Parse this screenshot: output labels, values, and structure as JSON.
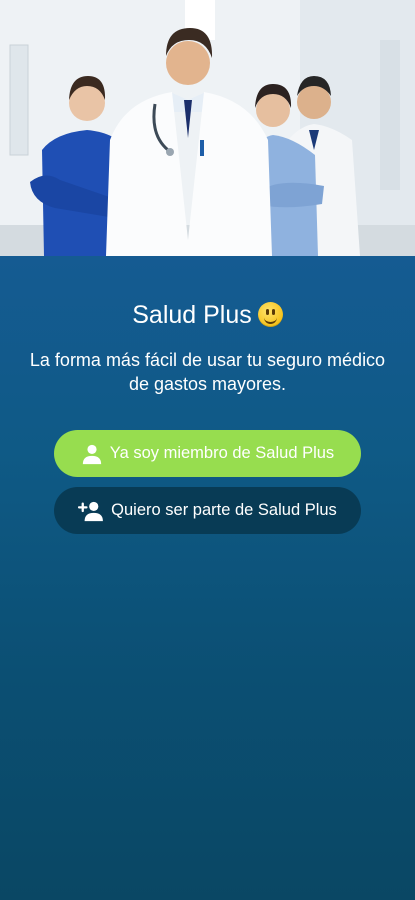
{
  "app": {
    "name": "Salud Plus"
  },
  "hero": {
    "image": "doctors-team-photo"
  },
  "header": {
    "title": "Salud Plus",
    "emoji_icon": "smiling-face-icon"
  },
  "tagline": "La forma más fácil de usar tu seguro médico de gastos mayores.",
  "buttons": {
    "member": {
      "label": "Ya soy miembro de Salud Plus",
      "icon": "user-icon",
      "color": "#97dd4f"
    },
    "join": {
      "label": "Quiero ser parte de Salud Plus",
      "icon": "add-user-icon",
      "color": "#083b55"
    }
  },
  "colors": {
    "panel_top": "#155b92",
    "panel_bottom": "#0a4764",
    "text": "#ffffff"
  }
}
